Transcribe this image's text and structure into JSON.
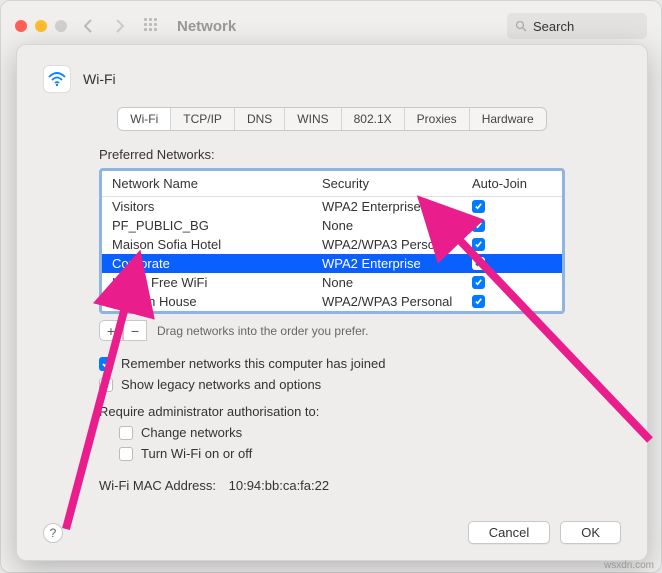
{
  "window": {
    "title": "Network",
    "search_placeholder": "Search"
  },
  "sheet": {
    "title": "Wi-Fi",
    "tabs": [
      "Wi-Fi",
      "TCP/IP",
      "DNS",
      "WINS",
      "802.1X",
      "Proxies",
      "Hardware"
    ],
    "active_tab": 0,
    "preferred_label": "Preferred Networks:",
    "columns": {
      "name": "Network Name",
      "security": "Security",
      "auto": "Auto-Join"
    },
    "networks": [
      {
        "name": "Visitors",
        "security": "WPA2 Enterprise",
        "auto": true,
        "selected": false
      },
      {
        "name": "PF_PUBLIC_BG",
        "security": "None",
        "auto": true,
        "selected": false
      },
      {
        "name": "Maison Sofia Hotel",
        "security": "WPA2/WPA3 Personal",
        "auto": true,
        "selected": false
      },
      {
        "name": "Corporate",
        "security": "WPA2 Enterprise",
        "auto": true,
        "selected": true
      },
      {
        "name": "Harpa Free WiFi",
        "security": "None",
        "auto": true,
        "selected": false
      },
      {
        "name": "Garden House",
        "security": "WPA2/WPA3 Personal",
        "auto": true,
        "selected": false
      }
    ],
    "drag_hint": "Drag networks into the order you prefer.",
    "remember": {
      "label": "Remember networks this computer has joined",
      "checked": true
    },
    "legacy": {
      "label": "Show legacy networks and options",
      "checked": false
    },
    "admin_label": "Require administrator authorisation to:",
    "admin_change": {
      "label": "Change networks",
      "checked": false
    },
    "admin_wifi": {
      "label": "Turn Wi-Fi on or off",
      "checked": false
    },
    "mac_label": "Wi-Fi MAC Address:",
    "mac_value": "10:94:bb:ca:fa:22",
    "cancel": "Cancel",
    "ok": "OK"
  },
  "watermark": "wsxdn.com"
}
